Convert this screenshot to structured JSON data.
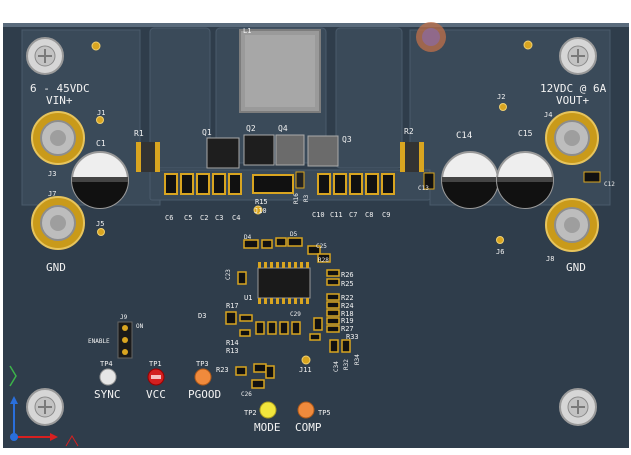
{
  "board": {
    "vin_range": "6 - 45VDC",
    "vin_label": "VIN+",
    "vout_rating": "12VDC @ 6A",
    "vout_label": "VOUT+",
    "gnd_left": "GND",
    "gnd_right": "GND",
    "enable_label": "ENABLE",
    "on_label": "ON"
  },
  "designators": {
    "L1": "L1",
    "R1": "R1",
    "R2": "R2",
    "Q1": "Q1",
    "Q2": "Q2",
    "Q3": "Q3",
    "Q4": "Q4",
    "C1": "C1",
    "C14": "C14",
    "C15": "C15",
    "C12": "C12",
    "C13": "C13",
    "J1": "J1",
    "J2": "J2",
    "J3": "J3",
    "J4": "J4",
    "J5": "J5",
    "J6": "J6",
    "J7": "J7",
    "J8": "J8",
    "J9": "J9",
    "J10": "J10",
    "J11": "J11",
    "R15": "R15",
    "R16": "R16",
    "R3": "R3",
    "C6": "C6",
    "C5": "C5",
    "C2": "C2",
    "C3": "C3",
    "C4": "C4",
    "C10": "C10",
    "C11": "C11",
    "C7": "C7",
    "C8": "C8",
    "C9": "C9",
    "U1": "U1",
    "D3": "D3",
    "D4": "D4",
    "D5": "D5",
    "R26": "R26",
    "R25": "R25",
    "R22": "R22",
    "R24": "R24",
    "R18": "R18",
    "R19": "R19",
    "R27": "R27",
    "R17": "R17",
    "R14": "R14",
    "R13": "R13",
    "R33": "R33",
    "R32": "R32",
    "R34": "R34",
    "R23": "R23",
    "C25": "C25",
    "C23": "C23",
    "C29": "C29",
    "C34": "C34",
    "C26": "C26",
    "R28": "R28"
  },
  "test_points": [
    {
      "id": "TP4",
      "label": "SYNC",
      "color": "#e6e6e6"
    },
    {
      "id": "TP1",
      "label": "VCC",
      "color": "#d32020"
    },
    {
      "id": "TP3",
      "label": "PGOOD",
      "color": "#f08a3c"
    },
    {
      "id": "TP2",
      "label": "MODE",
      "color": "#f2e63c"
    },
    {
      "id": "TP5",
      "label": "COMP",
      "color": "#f08a3c"
    }
  ],
  "colors": {
    "board": "#2f3d4b",
    "copper_pour": "#3a4a59",
    "silkscreen": "#f2f2f2",
    "pad_gold": "#d9a520",
    "cap_body": "#eeeeee"
  },
  "axis": {
    "x_icon": "x-axis-arrow",
    "y_icon": "y-axis-arrow"
  }
}
